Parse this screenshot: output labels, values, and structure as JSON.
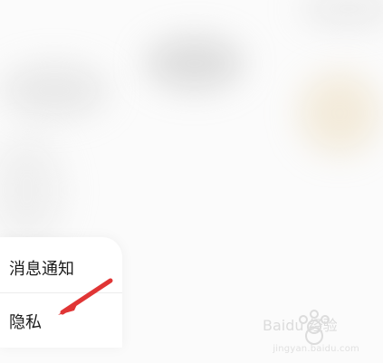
{
  "menu": {
    "items": [
      {
        "label": "消息通知"
      },
      {
        "label": "隐私"
      }
    ]
  },
  "overlay": {
    "arrow_color": "#e03535"
  },
  "watermark": {
    "logo_text": "Baidu 经验",
    "domain": "jingyan.baidu.com"
  }
}
